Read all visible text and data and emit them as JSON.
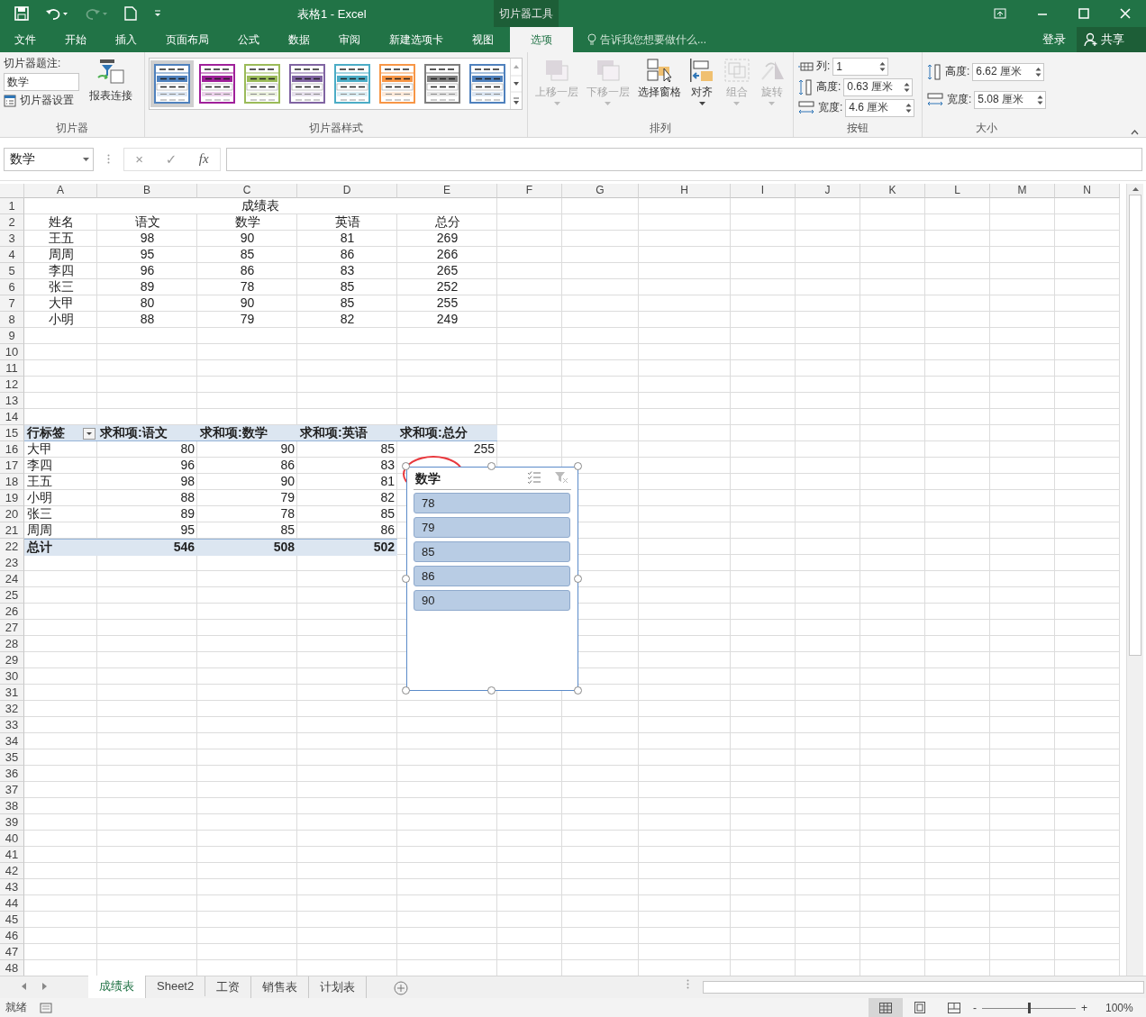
{
  "window": {
    "title": "表格1 - Excel",
    "context_tab": "切片器工具"
  },
  "tabs": [
    {
      "label": "文件",
      "selected": false
    },
    {
      "label": "开始",
      "selected": false
    },
    {
      "label": "插入",
      "selected": false
    },
    {
      "label": "页面布局",
      "selected": false
    },
    {
      "label": "公式",
      "selected": false
    },
    {
      "label": "数据",
      "selected": false
    },
    {
      "label": "审阅",
      "selected": false
    },
    {
      "label": "新建选项卡",
      "selected": false
    },
    {
      "label": "视图",
      "selected": false
    },
    {
      "label": "选项",
      "selected": true
    }
  ],
  "tell_me": {
    "placeholder": "告诉我您想要做什么..."
  },
  "account": {
    "login": "登录",
    "share": "共享"
  },
  "ribbon": {
    "slicer_group": {
      "caption_label": "切片器题注:",
      "caption_value": "数学",
      "settings": "切片器设置",
      "connections": "报表连接",
      "label": "切片器"
    },
    "styles_group": {
      "label": "切片器样式",
      "styles": [
        {
          "color": "#4f81bd",
          "selected": true
        },
        {
          "color": "#a0209a",
          "selected": false
        },
        {
          "color": "#9bbb59",
          "selected": false
        },
        {
          "color": "#8064a2",
          "selected": false
        },
        {
          "color": "#4bacc6",
          "selected": false
        },
        {
          "color": "#f79646",
          "selected": false
        },
        {
          "color": "#7f7f7f",
          "selected": false
        },
        {
          "color": "#4f81bd",
          "selected": false
        }
      ]
    },
    "arrange_group": {
      "label": "排列",
      "buttons": [
        {
          "label": "上移一层",
          "kind": "forward",
          "disabled": true,
          "dropdown": true
        },
        {
          "label": "下移一层",
          "kind": "backward",
          "disabled": true,
          "dropdown": true
        },
        {
          "label": "选择窗格",
          "kind": "pane",
          "disabled": false,
          "dropdown": false
        },
        {
          "label": "对齐",
          "kind": "align",
          "disabled": false,
          "dropdown": true
        },
        {
          "label": "组合",
          "kind": "group",
          "disabled": true,
          "dropdown": true
        },
        {
          "label": "旋转",
          "kind": "rotate",
          "disabled": true,
          "dropdown": true
        }
      ]
    },
    "buttons_group": {
      "label": "按钮",
      "fields": [
        {
          "kind": "columns",
          "label": "列:",
          "value": "1"
        },
        {
          "kind": "height",
          "label": "高度:",
          "value": "0.63 厘米"
        },
        {
          "kind": "width",
          "label": "宽度:",
          "value": "4.6 厘米"
        }
      ]
    },
    "size_group": {
      "label": "大小",
      "fields": [
        {
          "kind": "height",
          "label": "高度:",
          "value": "6.62 厘米"
        },
        {
          "kind": "width",
          "label": "宽度:",
          "value": "5.08 厘米"
        }
      ]
    }
  },
  "formula_bar": {
    "name_box": "数学",
    "cancel": "×",
    "enter": "✓",
    "function": "fx"
  },
  "sheet": {
    "columns": [
      "A",
      "B",
      "C",
      "D",
      "E",
      "F",
      "G",
      "H",
      "I",
      "J",
      "K",
      "L",
      "M",
      "N"
    ],
    "rows": [
      {
        "n": "1",
        "kind": "title",
        "cells": [
          "成绩表"
        ]
      },
      {
        "n": "2",
        "kind": "table",
        "cells": [
          "姓名",
          "语文",
          "数学",
          "英语",
          "总分"
        ]
      },
      {
        "n": "3",
        "kind": "table",
        "cells": [
          "王五",
          "98",
          "90",
          "81",
          "269"
        ]
      },
      {
        "n": "4",
        "kind": "table",
        "cells": [
          "周周",
          "95",
          "85",
          "86",
          "266"
        ]
      },
      {
        "n": "5",
        "kind": "table",
        "cells": [
          "李四",
          "96",
          "86",
          "83",
          "265"
        ]
      },
      {
        "n": "6",
        "kind": "table",
        "cells": [
          "张三",
          "89",
          "78",
          "85",
          "252"
        ]
      },
      {
        "n": "7",
        "kind": "table",
        "cells": [
          "大甲",
          "80",
          "90",
          "85",
          "255"
        ]
      },
      {
        "n": "8",
        "kind": "table",
        "cells": [
          "小明",
          "88",
          "79",
          "82",
          "249"
        ]
      },
      {
        "n": "9"
      },
      {
        "n": "10"
      },
      {
        "n": "11"
      },
      {
        "n": "12"
      },
      {
        "n": "13"
      },
      {
        "n": "14"
      },
      {
        "n": "15",
        "kind": "pivot-header",
        "cells": [
          "行标签",
          "求和项:语文",
          "求和项:数学",
          "求和项:英语",
          "求和项:总分"
        ]
      },
      {
        "n": "16",
        "kind": "pivot-row",
        "cells": [
          "大甲",
          "80",
          "90",
          "85",
          "255"
        ]
      },
      {
        "n": "17",
        "kind": "pivot-row",
        "cells": [
          "李四",
          "96",
          "86",
          "83"
        ]
      },
      {
        "n": "18",
        "kind": "pivot-row",
        "cells": [
          "王五",
          "98",
          "90",
          "81"
        ]
      },
      {
        "n": "19",
        "kind": "pivot-row",
        "cells": [
          "小明",
          "88",
          "79",
          "82"
        ]
      },
      {
        "n": "20",
        "kind": "pivot-row",
        "cells": [
          "张三",
          "89",
          "78",
          "85"
        ]
      },
      {
        "n": "21",
        "kind": "pivot-row",
        "cells": [
          "周周",
          "95",
          "85",
          "86"
        ]
      },
      {
        "n": "22",
        "kind": "pivot-total",
        "cells": [
          "总计",
          "546",
          "508",
          "502"
        ]
      },
      {
        "n": "23"
      },
      {
        "n": "24"
      },
      {
        "n": "25"
      },
      {
        "n": "26"
      },
      {
        "n": "27"
      },
      {
        "n": "28"
      },
      {
        "n": "29"
      },
      {
        "n": "30"
      },
      {
        "n": "31"
      },
      {
        "n": "32"
      },
      {
        "n": "33"
      },
      {
        "n": "34"
      },
      {
        "n": "35"
      },
      {
        "n": "36"
      },
      {
        "n": "37"
      },
      {
        "n": "38"
      },
      {
        "n": "39"
      },
      {
        "n": "40"
      },
      {
        "n": "41"
      },
      {
        "n": "42"
      },
      {
        "n": "43"
      },
      {
        "n": "44"
      },
      {
        "n": "45"
      },
      {
        "n": "46"
      },
      {
        "n": "47"
      },
      {
        "n": "48"
      }
    ]
  },
  "slicer": {
    "title": "数学",
    "items": [
      {
        "label": "78",
        "selected": true
      },
      {
        "label": "79",
        "selected": true
      },
      {
        "label": "85",
        "selected": true
      },
      {
        "label": "86",
        "selected": true
      },
      {
        "label": "90",
        "selected": true
      }
    ]
  },
  "sheet_tabs": [
    {
      "label": "成绩表",
      "selected": true
    },
    {
      "label": "Sheet2",
      "selected": false
    },
    {
      "label": "工资",
      "selected": false
    },
    {
      "label": "销售表",
      "selected": false
    },
    {
      "label": "计划表",
      "selected": false
    }
  ],
  "status_bar": {
    "status": "就绪",
    "views": [
      {
        "kind": "normal",
        "selected": true
      },
      {
        "kind": "layout",
        "selected": false
      },
      {
        "kind": "break",
        "selected": false
      }
    ],
    "zoom_out": "-",
    "zoom_in": "+",
    "zoom": {
      "level": 0.5
    },
    "zoom_text": "100%"
  }
}
